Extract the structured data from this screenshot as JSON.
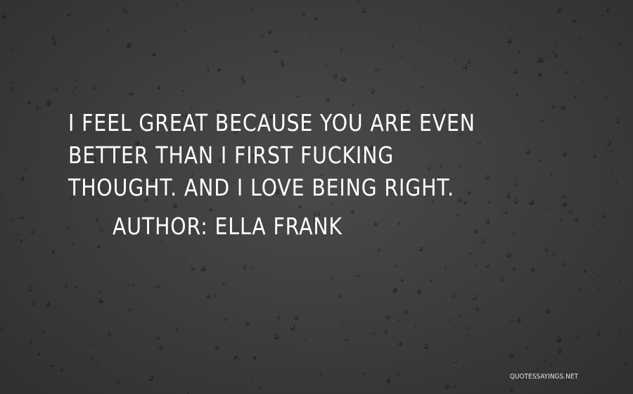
{
  "quote": {
    "text": "I feel great because you are even better than I first fucking thought. And I love being right.",
    "author_line": "AUTHOR: ELLA FRANK"
  },
  "watermark": {
    "text": "QUOTESSAYINGS.NET"
  },
  "colors": {
    "background": "#3d3d3d",
    "text": "#ffffff"
  }
}
